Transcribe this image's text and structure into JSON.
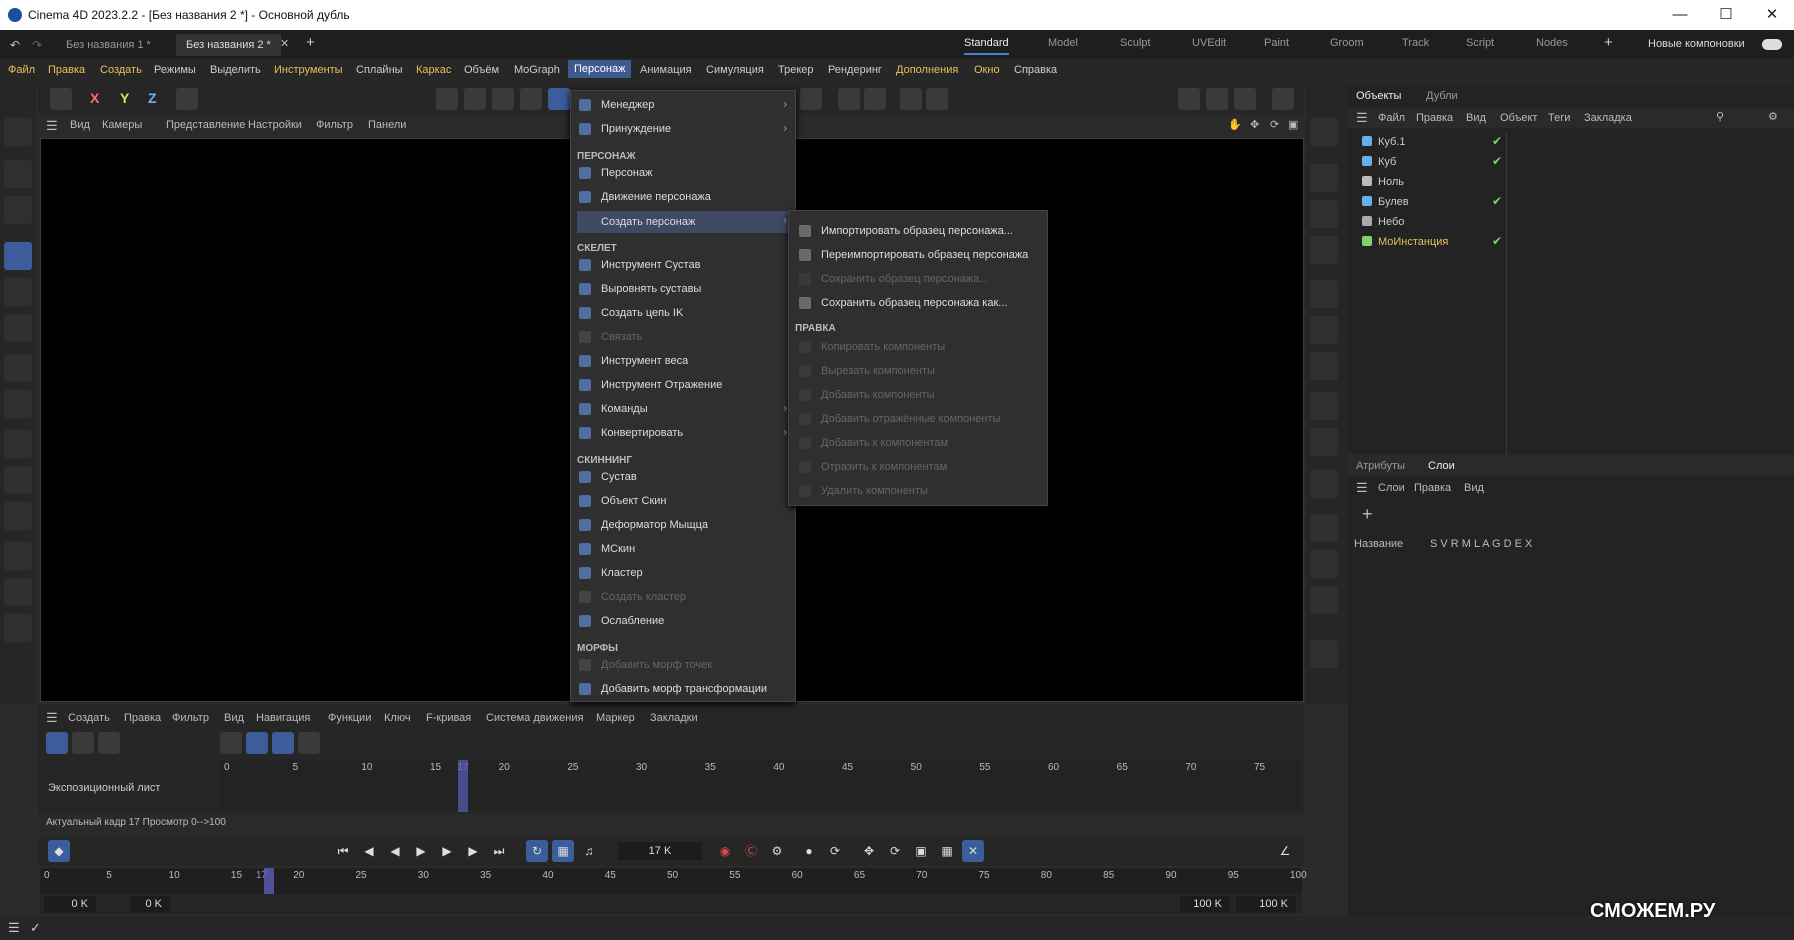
{
  "window": {
    "title": "Cinema 4D 2023.2.2 - [Без названия 2 *] - Основной дубль"
  },
  "doc_tabs": [
    "Без названия 1 *",
    "Без названия 2 *"
  ],
  "layouts": [
    "Standard",
    "Model",
    "Sculpt",
    "UVEdit",
    "Paint",
    "Groom",
    "Track",
    "Script",
    "Nodes"
  ],
  "new_layouts_label": "Новые компоновки",
  "menubar": [
    "Файл",
    "Правка",
    "Создать",
    "Режимы",
    "Выделить",
    "Инструменты",
    "Сплайны",
    "Каркас",
    "Объём",
    "MoGraph",
    "Персонаж",
    "Анимация",
    "Симуляция",
    "Трекер",
    "Рендеринг",
    "Дополнения",
    "Окно",
    "Справка"
  ],
  "viewport_menu": [
    "Вид",
    "Камеры",
    "Представление",
    "Настройки",
    "Фильтр",
    "Панели"
  ],
  "axis_labels": [
    "X",
    "Y",
    "Z"
  ],
  "menu_character": {
    "items": [
      {
        "label": "Менеджер",
        "arrow": true
      },
      {
        "label": "Принуждение",
        "arrow": true
      },
      {
        "header": "ПЕРСОНАЖ"
      },
      {
        "label": "Персонаж"
      },
      {
        "label": "Движение персонажа"
      },
      {
        "label": "Создать персонаж",
        "arrow": true,
        "highlight": true
      },
      {
        "header": "СКЕЛЕТ"
      },
      {
        "label": "Инструмент Сустав"
      },
      {
        "label": "Выровнять суставы"
      },
      {
        "label": "Создать цепь IK"
      },
      {
        "label": "Связать",
        "disabled": true
      },
      {
        "label": "Инструмент веса"
      },
      {
        "label": "Инструмент Отражение"
      },
      {
        "label": "Команды",
        "arrow": true
      },
      {
        "label": "Конвертировать",
        "arrow": true
      },
      {
        "header": "СКИННИНГ"
      },
      {
        "label": "Сустав"
      },
      {
        "label": "Объект Скин"
      },
      {
        "label": "Деформатор Мыщца"
      },
      {
        "label": "МСкин"
      },
      {
        "label": "Кластер"
      },
      {
        "label": "Создать кластер",
        "disabled": true
      },
      {
        "label": "Ослабление"
      },
      {
        "header": "МОРФЫ"
      },
      {
        "label": "Добавить морф точек",
        "disabled": true
      },
      {
        "label": "Добавить морф трансформации"
      }
    ]
  },
  "menu_create_character": {
    "items": [
      {
        "label": "Импортировать образец персонажа..."
      },
      {
        "label": "Переимпортировать образец персонажа"
      },
      {
        "label": "Сохранить образец персонажа...",
        "disabled": true
      },
      {
        "label": "Сохранить образец персонажа как..."
      },
      {
        "header": "ПРАВКА"
      },
      {
        "label": "Копировать компоненты",
        "disabled": true
      },
      {
        "label": "Вырезать компоненты",
        "disabled": true
      },
      {
        "label": "Добавить компоненты",
        "disabled": true
      },
      {
        "label": "Добавить отражённые компоненты",
        "disabled": true
      },
      {
        "label": "Добавить к компонентам",
        "disabled": true
      },
      {
        "label": "Отразить к компонентам",
        "disabled": true
      },
      {
        "label": "Удалить компоненты",
        "disabled": true
      }
    ]
  },
  "objects_panel": {
    "tabs": [
      "Объекты",
      "Дубли"
    ],
    "menu": [
      "Файл",
      "Правка",
      "Вид",
      "Объект",
      "Теги",
      "Закладка"
    ],
    "objects": [
      {
        "name": "Куб.1",
        "check": true
      },
      {
        "name": "Куб",
        "check": true
      },
      {
        "name": "Ноль",
        "check": false
      },
      {
        "name": "Булев",
        "check": true
      },
      {
        "name": "Небо",
        "check": false
      },
      {
        "name": "МоИнстанция",
        "check": true,
        "color": "#e6c15a"
      }
    ]
  },
  "layers_panel": {
    "tabs": [
      "Атрибуты",
      "Слои"
    ],
    "menu": [
      "Слои",
      "Правка",
      "Вид"
    ],
    "col_name": "Название",
    "col_flags": "S V R M L A G D E X"
  },
  "timeline": {
    "menu": [
      "Создать",
      "Правка",
      "Фильтр",
      "Вид",
      "Навигация",
      "Функции",
      "Ключ",
      "F-кривая",
      "Система движения",
      "Маркер",
      "Закладки"
    ],
    "track_label": "Экспозиционный лист",
    "ruler_ticks": [
      "0",
      "5",
      "10",
      "15",
      "17",
      "20",
      "25",
      "30",
      "35",
      "40",
      "45",
      "50",
      "55",
      "60",
      "65",
      "70",
      "75"
    ],
    "status": "Актуальный кадр  17  Просмотр  0-->100"
  },
  "transport": {
    "frame_field": "17 K"
  },
  "frame_ruler_ticks": [
    "0",
    "5",
    "10",
    "15",
    "17",
    "20",
    "25",
    "30",
    "35",
    "40",
    "45",
    "50",
    "55",
    "60",
    "65",
    "70",
    "75",
    "80",
    "85",
    "90",
    "95",
    "100"
  ],
  "bottom_fields": [
    "0 K",
    "0 K",
    "100 K",
    "100 K"
  ],
  "watermark": "СМОЖЕМ.РУ"
}
